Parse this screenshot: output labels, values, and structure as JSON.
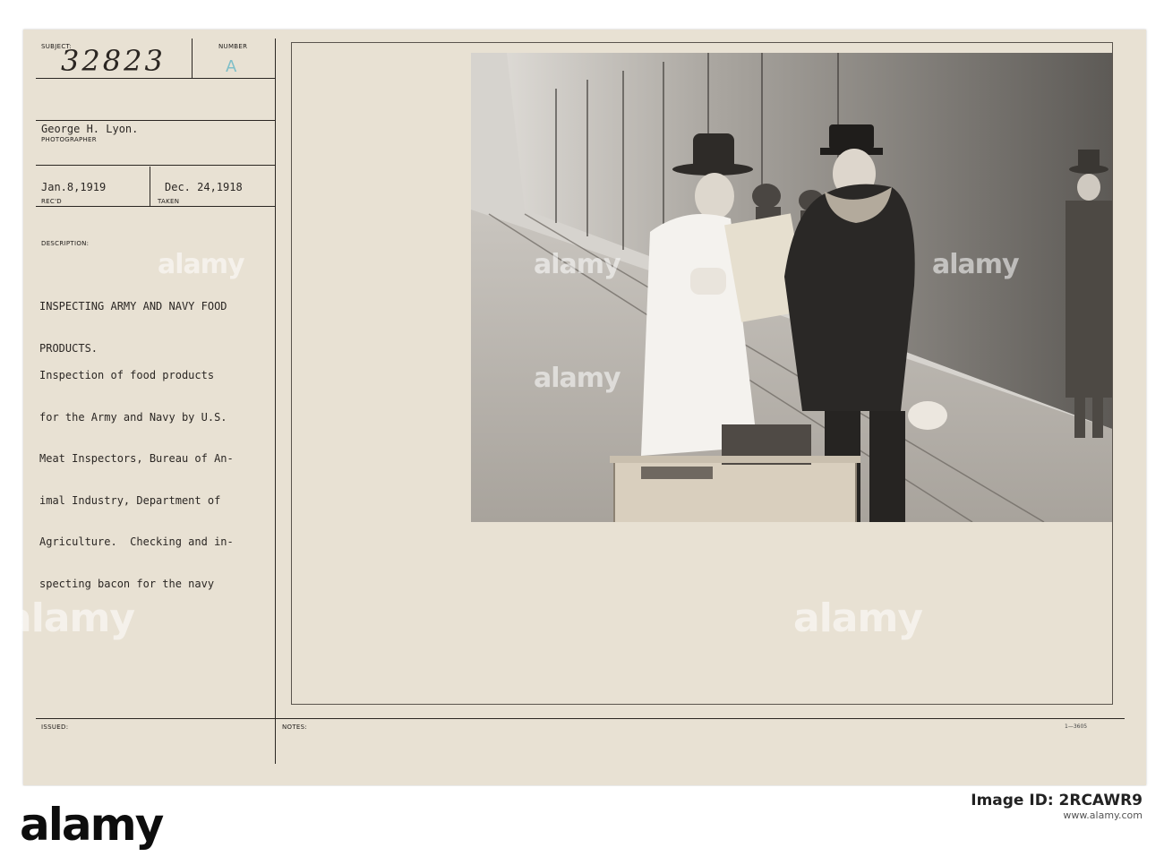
{
  "card": {
    "subject_label": "SUBJECT:",
    "number_label": "NUMBER",
    "subject_number": "32823",
    "number_letter": "A",
    "photographer_name": "George H. Lyon.",
    "photographer_label": "PHOTOGRAPHER",
    "received_date": "Jan.8,1919",
    "received_label": "REC'D",
    "taken_date": "Dec. 24,1918",
    "taken_label": "TAKEN",
    "description_label": "DESCRIPTION:",
    "title_lines": [
      "INSPECTING ARMY AND NAVY FOOD",
      "PRODUCTS."
    ],
    "body_lines": [
      "Inspection of food products",
      "for the Army and Navy by U.S.",
      "Meat Inspectors, Bureau of An-",
      "imal Industry, Department of",
      "Agriculture.  Checking and in-",
      "specting bacon for the navy"
    ],
    "issued_label": "ISSUED:",
    "notes_label": "NOTES:",
    "form_number": "1—3605"
  },
  "watermark": {
    "text": "alamy"
  },
  "alamy_bar": {
    "logo": "alamy",
    "image_id_label": "Image ID: 2RCAWR9",
    "url": "www.alamy.com"
  }
}
